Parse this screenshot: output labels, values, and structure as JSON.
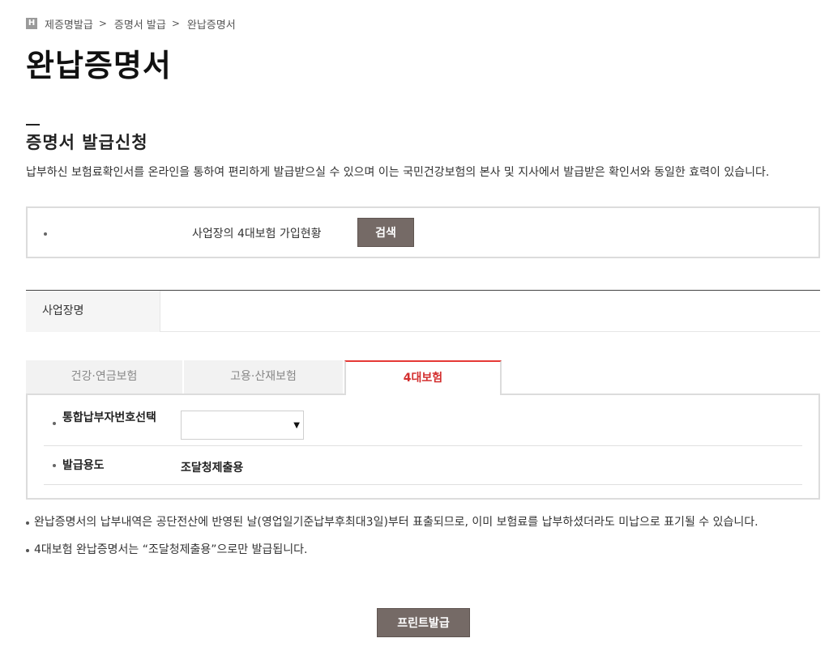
{
  "breadcrumb": {
    "home_icon": "H",
    "items": [
      "제증명발급",
      "증명서 발급",
      "완납증명서"
    ],
    "separator": ">"
  },
  "page_title": "완납증명서",
  "section": {
    "title": "증명서 발급신청",
    "intro": "납부하신 보험료확인서를 온라인을 통하여 편리하게 발급받으실 수 있으며 이는 국민건강보험의 본사 및 지사에서 발급받은 확인서와 동일한 효력이 있습니다."
  },
  "search": {
    "label": "사업장의 4대보험 가입현황",
    "button": "검색"
  },
  "info_table": {
    "header": "사업장명",
    "value": ""
  },
  "tabs": [
    {
      "label": "건강·연금보험",
      "active": false
    },
    {
      "label": "고용·산재보험",
      "active": false
    },
    {
      "label": "4대보험",
      "active": true
    }
  ],
  "form": {
    "row1_label": "통합납부자번호선택",
    "row1_select_value": "",
    "row2_label": "발급용도",
    "row2_value": "조달청제출용"
  },
  "notes": [
    "완납증명서의 납부내역은 공단전산에 반영된 날(영업일기준납부후최대3일)부터 표출되므로, 이미 보험료를 납부하셨더라도 미납으로 표기될 수 있습니다.",
    "4대보험 완납증명서는 “조달청제출용”으로만 발급됩니다."
  ],
  "print_button": "프린트발급",
  "colors": {
    "button_bg": "#756a66",
    "active_tab_text": "#d32f2f",
    "active_tab_border": "#e53935"
  },
  "icons": {
    "home": "home-icon",
    "select_arrow": "chevron-down-icon"
  }
}
